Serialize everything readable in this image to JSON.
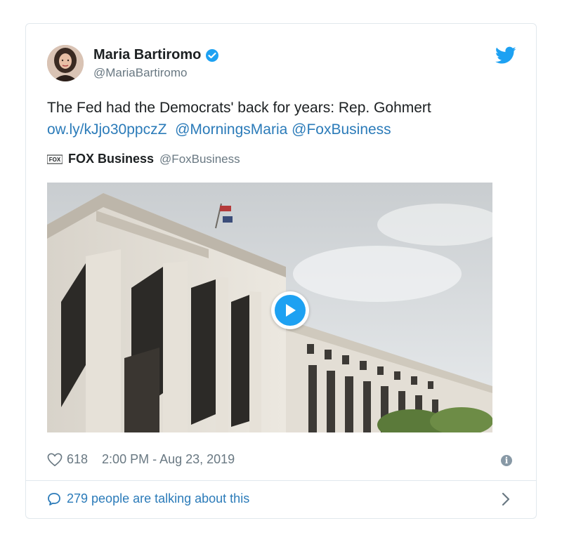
{
  "user": {
    "name": "Maria Bartiromo",
    "handle": "@MariaBartiromo",
    "verified": true
  },
  "tweet": {
    "text": "The Fed had the Democrats' back for years: Rep. Gohmert",
    "links": [
      "ow.ly/kJjo30ppczZ",
      "@MorningsMaria",
      "@FoxBusiness"
    ]
  },
  "source": {
    "logo_text": "FOX",
    "name": "FOX Business",
    "handle": "@FoxBusiness"
  },
  "media": {
    "type": "video",
    "icon": "play-icon"
  },
  "meta": {
    "likes": "618",
    "timestamp": "2:00 PM - Aug 23, 2019"
  },
  "footer": {
    "talking": "279 people are talking about this"
  },
  "colors": {
    "link": "#2b7bb9",
    "twitter_blue": "#1da1f2",
    "muted": "#697882",
    "border": "#e1e8ed"
  }
}
